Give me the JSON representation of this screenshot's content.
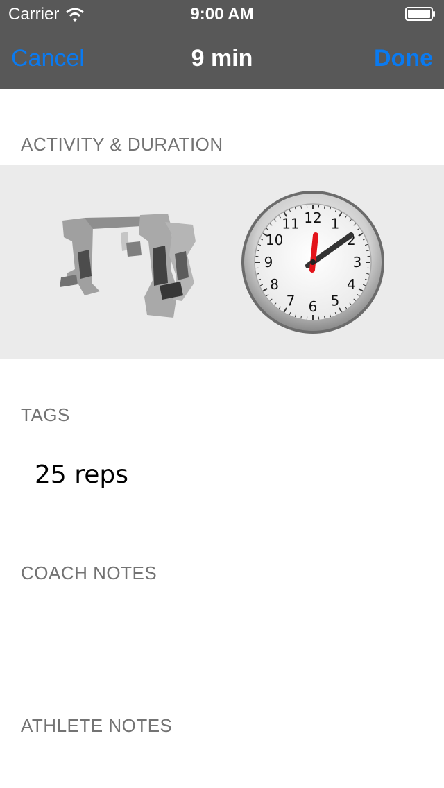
{
  "status_bar": {
    "carrier": "Carrier",
    "time": "9:00 AM"
  },
  "nav": {
    "cancel_label": "Cancel",
    "title": "9 min",
    "done_label": "Done"
  },
  "sections": {
    "activity_header": "ACTIVITY & DURATION",
    "tags_header": "TAGS",
    "coach_notes_header": "COACH NOTES",
    "athlete_notes_header": "ATHLETE NOTES"
  },
  "tags": {
    "value": "25 reps"
  },
  "clock": {
    "numbers": [
      "12",
      "1",
      "2",
      "3",
      "4",
      "5",
      "6",
      "7",
      "8",
      "9",
      "10",
      "11"
    ]
  },
  "icons": {
    "activity": "exercise-machine-icon",
    "duration": "clock-icon",
    "wifi": "wifi-icon",
    "battery": "battery-icon"
  },
  "colors": {
    "accent": "#0a7af0",
    "nav_bg": "#585858",
    "panel_bg": "#ebebeb",
    "hour_hand": "#e3141b"
  }
}
